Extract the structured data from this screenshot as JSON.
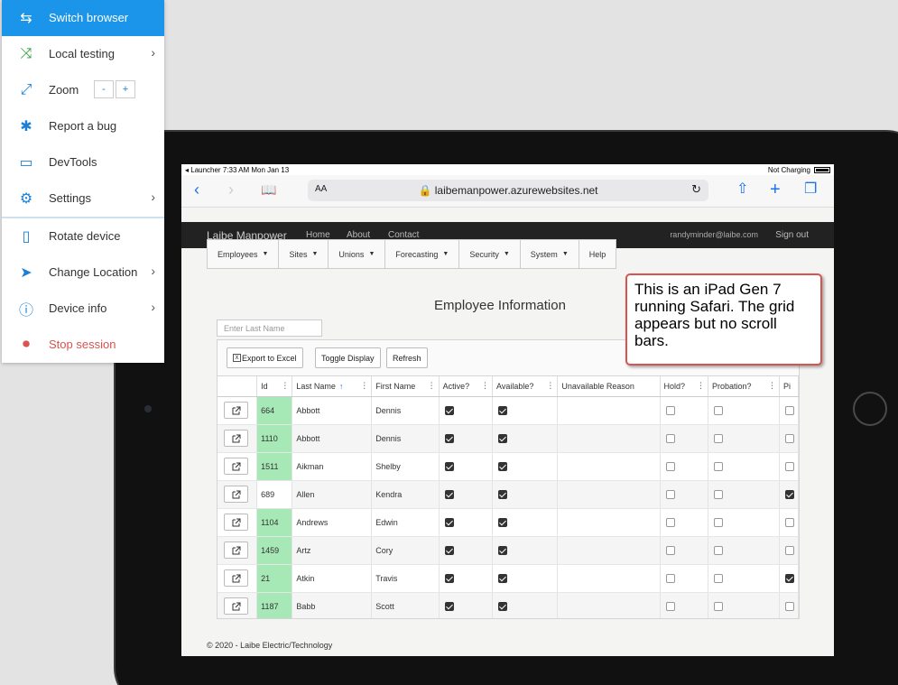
{
  "panel": {
    "items": [
      {
        "label": "Switch browser",
        "icon": "switch-browser-icon",
        "glyph": "⇆",
        "chevron": false
      },
      {
        "label": "Local testing",
        "icon": "local-testing-icon",
        "glyph": "⤨",
        "chevron": true
      },
      {
        "label": "Zoom",
        "icon": "zoom-icon",
        "glyph": "⤢",
        "chevron": false
      },
      {
        "label": "Report a bug",
        "icon": "bug-icon",
        "glyph": "✱",
        "chevron": false
      },
      {
        "label": "DevTools",
        "icon": "devtools-icon",
        "glyph": "▭",
        "chevron": false
      },
      {
        "label": "Settings",
        "icon": "gear-icon",
        "glyph": "⚙",
        "chevron": true
      },
      {
        "label": "Rotate device",
        "icon": "rotate-device-icon",
        "glyph": "▯",
        "chevron": false
      },
      {
        "label": "Change Location",
        "icon": "location-icon",
        "glyph": "➤",
        "chevron": true
      },
      {
        "label": "Device info",
        "icon": "info-icon",
        "glyph": "ⓘ",
        "chevron": true
      },
      {
        "label": "Stop session",
        "icon": "stop-icon",
        "glyph": "⏺",
        "chevron": false
      }
    ],
    "zoom_minus": "-",
    "zoom_plus": "+",
    "chevron_glyph": "›"
  },
  "statusbar": {
    "left": "◂ Launcher   7:33 AM   Mon Jan 13",
    "right": "Not Charging"
  },
  "safari": {
    "aa": "AA",
    "url": "🔒 laibemanpower.azurewebsites.net",
    "back": "‹",
    "forward": "›",
    "book": "📖",
    "reload": "↻",
    "share": "⇧",
    "plus": "+",
    "tabs": "❐"
  },
  "app": {
    "brand": "Laibe Manpower",
    "links": [
      "Home",
      "About",
      "Contact"
    ],
    "user": "randyminder@laibe.com",
    "signout": "Sign out",
    "menu": [
      {
        "label": "Employees",
        "caret": true
      },
      {
        "label": "Sites",
        "caret": true
      },
      {
        "label": "Unions",
        "caret": true
      },
      {
        "label": "Forecasting",
        "caret": true
      },
      {
        "label": "Security",
        "caret": true
      },
      {
        "label": "System",
        "caret": true
      },
      {
        "label": "Help",
        "caret": false
      }
    ],
    "page_title": "Employee Information",
    "search_placeholder": "Enter Last Name",
    "toolbar": {
      "export": "Export to Excel",
      "toggle": "Toggle Display",
      "refresh": "Refresh"
    },
    "columns": [
      "Id",
      "Last Name",
      "First Name",
      "Active?",
      "Available?",
      "Unavailable Reason",
      "Hold?",
      "Probation?",
      "Pi"
    ],
    "rows": [
      {
        "id": "664",
        "last": "Abbott",
        "first": "Dennis",
        "active": true,
        "available": true,
        "hold": false,
        "probation": false,
        "p": false,
        "highlight": true
      },
      {
        "id": "1110",
        "last": "Abbott",
        "first": "Dennis",
        "active": true,
        "available": true,
        "hold": false,
        "probation": false,
        "p": false,
        "highlight": true
      },
      {
        "id": "1511",
        "last": "Aikman",
        "first": "Shelby",
        "active": true,
        "available": true,
        "hold": false,
        "probation": false,
        "p": false,
        "highlight": true
      },
      {
        "id": "689",
        "last": "Allen",
        "first": "Kendra",
        "active": true,
        "available": true,
        "hold": false,
        "probation": false,
        "p": true,
        "highlight": false
      },
      {
        "id": "1104",
        "last": "Andrews",
        "first": "Edwin",
        "active": true,
        "available": true,
        "hold": false,
        "probation": false,
        "p": false,
        "highlight": true
      },
      {
        "id": "1459",
        "last": "Artz",
        "first": "Cory",
        "active": true,
        "available": true,
        "hold": false,
        "probation": false,
        "p": false,
        "highlight": true
      },
      {
        "id": "21",
        "last": "Atkin",
        "first": "Travis",
        "active": true,
        "available": true,
        "hold": false,
        "probation": false,
        "p": true,
        "highlight": true
      },
      {
        "id": "1187",
        "last": "Babb",
        "first": "Scott",
        "active": true,
        "available": true,
        "hold": false,
        "probation": false,
        "p": false,
        "highlight": true
      }
    ],
    "footer": "© 2020 - Laibe Electric/Technology"
  },
  "callout": {
    "text": "This is an iPad Gen 7 running Safari. The grid appears but no scroll bars."
  },
  "colors": {
    "accent": "#1a95ea",
    "id_highlight": "#a6e8b6",
    "stop": "#d9534f",
    "callout_border": "#d9534f"
  }
}
